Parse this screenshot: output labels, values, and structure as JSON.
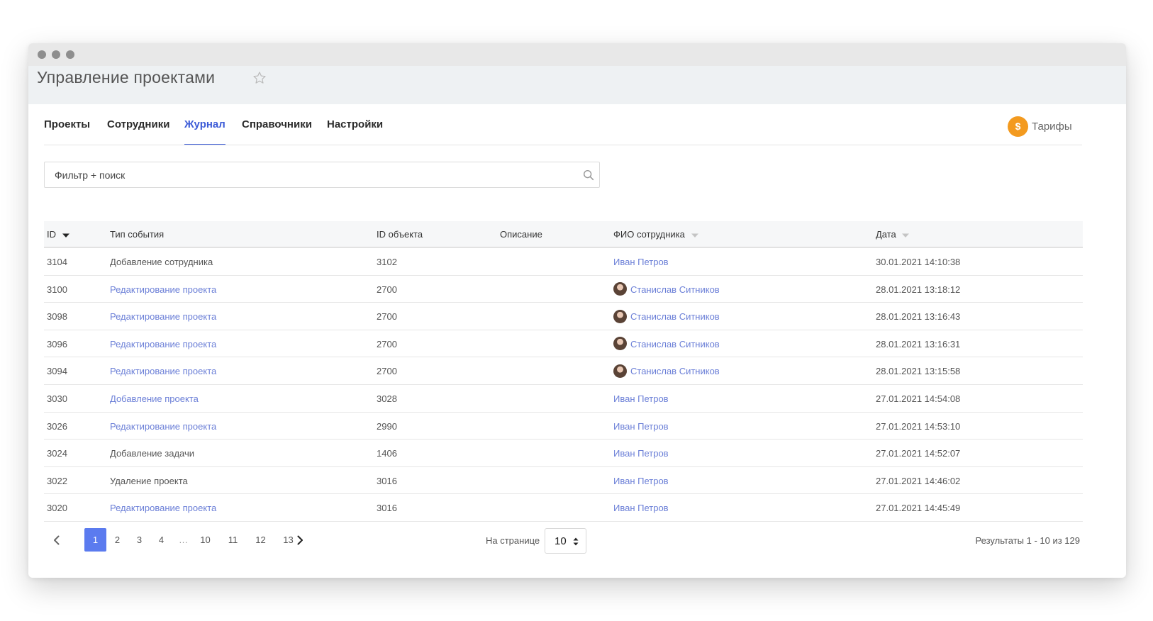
{
  "window": {
    "title": "Управление проектами"
  },
  "tabs": [
    {
      "label": "Проекты",
      "active": false
    },
    {
      "label": "Сотрудники",
      "active": false
    },
    {
      "label": "Журнал",
      "active": true
    },
    {
      "label": "Справочники",
      "active": false
    },
    {
      "label": "Настройки",
      "active": false
    }
  ],
  "tariff": {
    "label": "Тарифы",
    "icon": "dollar-coin-icon",
    "color": "#f39a1f"
  },
  "search": {
    "placeholder": "Фильтр + поиск",
    "value": ""
  },
  "table": {
    "columns": {
      "id": "ID",
      "event_type": "Тип события",
      "object_id": "ID объекта",
      "description": "Описание",
      "employee": "ФИО сотрудника",
      "date": "Дата"
    },
    "rows": [
      {
        "id": "3104",
        "event_type": "Добавление сотрудника",
        "event_link": false,
        "object_id": "3102",
        "description": "",
        "employee": "Иван Петров",
        "avatar": false,
        "date": "30.01.2021 14:10:38"
      },
      {
        "id": "3100",
        "event_type": "Редактирование проекта",
        "event_link": true,
        "object_id": "2700",
        "description": "",
        "employee": "Станислав Ситников",
        "avatar": true,
        "date": "28.01.2021 13:18:12"
      },
      {
        "id": "3098",
        "event_type": "Редактирование проекта",
        "event_link": true,
        "object_id": "2700",
        "description": "",
        "employee": "Станислав Ситников",
        "avatar": true,
        "date": "28.01.2021 13:16:43"
      },
      {
        "id": "3096",
        "event_type": "Редактирование проекта",
        "event_link": true,
        "object_id": "2700",
        "description": "",
        "employee": "Станислав Ситников",
        "avatar": true,
        "date": "28.01.2021 13:16:31"
      },
      {
        "id": "3094",
        "event_type": "Редактирование проекта",
        "event_link": true,
        "object_id": "2700",
        "description": "",
        "employee": "Станислав Ситников",
        "avatar": true,
        "date": "28.01.2021 13:15:58"
      },
      {
        "id": "3030",
        "event_type": "Добавление проекта",
        "event_link": true,
        "object_id": "3028",
        "description": "",
        "employee": "Иван Петров",
        "avatar": false,
        "date": "27.01.2021 14:54:08"
      },
      {
        "id": "3026",
        "event_type": "Редактирование проекта",
        "event_link": true,
        "object_id": "2990",
        "description": "",
        "employee": "Иван Петров",
        "avatar": false,
        "date": "27.01.2021 14:53:10"
      },
      {
        "id": "3024",
        "event_type": "Добавление задачи",
        "event_link": false,
        "object_id": "1406",
        "description": "",
        "employee": "Иван Петров",
        "avatar": false,
        "date": "27.01.2021 14:52:07"
      },
      {
        "id": "3022",
        "event_type": "Удаление проекта",
        "event_link": false,
        "object_id": "3016",
        "description": "",
        "employee": "Иван Петров",
        "avatar": false,
        "date": "27.01.2021 14:46:02"
      },
      {
        "id": "3020",
        "event_type": "Редактирование проекта",
        "event_link": true,
        "object_id": "3016",
        "description": "",
        "employee": "Иван Петров",
        "avatar": false,
        "date": "27.01.2021 14:45:49"
      }
    ]
  },
  "pagination": {
    "pages": [
      "1",
      "2",
      "3",
      "4",
      "…",
      "10",
      "11",
      "12",
      "13"
    ],
    "current": "1",
    "per_page_label": "На странице",
    "per_page_value": "10",
    "results": "Результаты 1 - 10 из 129"
  },
  "colors": {
    "accent": "#3c5bd7",
    "link": "#6b7fd7",
    "page_active": "#5b7bef"
  }
}
